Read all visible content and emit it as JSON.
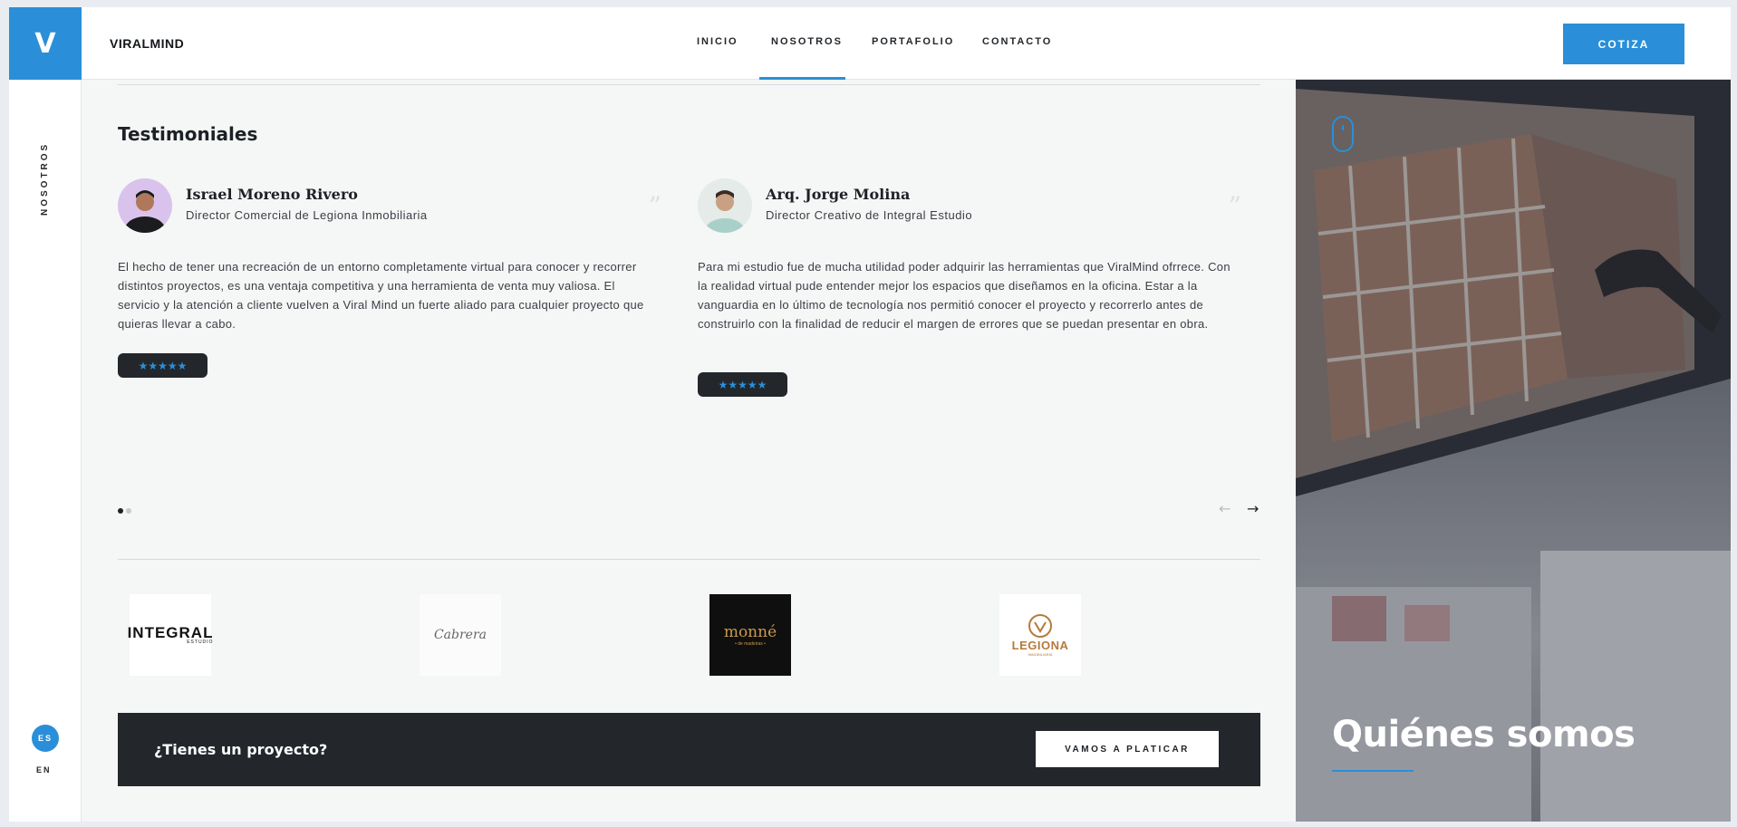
{
  "header": {
    "logo_letter": "V",
    "brand": "VIRALMIND",
    "nav": [
      {
        "label": "INICIO"
      },
      {
        "label": "NOSOTROS"
      },
      {
        "label": "PORTAFOLIO"
      },
      {
        "label": "CONTACTO"
      }
    ],
    "cta_label": "COTIZA"
  },
  "rail": {
    "section_label": "NOSOTROS",
    "lang_active": "ES",
    "lang_other": "EN"
  },
  "testimonials": {
    "title": "Testimoniales",
    "items": [
      {
        "name": "Israel Moreno Rivero",
        "role": "Director Comercial de Legiona Inmobiliaria",
        "quote_mark": "”",
        "text": "El hecho de tener una recreación de un entorno completamente virtual para conocer y recorrer distintos proyectos, es una ventaja competitiva y una herramienta de venta muy valiosa. El servicio y la atención a cliente vuelven a Viral Mind un fuerte aliado para cualquier proyecto que quieras llevar a cabo.",
        "rating": "★★★★★"
      },
      {
        "name": "Arq. Jorge Molina",
        "role": "Director Creativo de Integral Estudio",
        "quote_mark": "”",
        "text": "Para mi estudio fue de mucha utilidad poder adquirir las herramientas que ViralMind ofrrece. Con la realidad virtual pude entender mejor los espacios que diseñamos en la oficina. Estar a la vanguardia en lo último de tecnología nos permitió conocer el proyecto y recorrerlo antes de construirlo con la finalidad de reducir el margen de errores que se puedan presentar en obra.",
        "rating": "★★★★★"
      }
    ],
    "prev_arrow": "←",
    "next_arrow": "→"
  },
  "partners": [
    {
      "name": "INTEGRAL",
      "sub": "ESTUDIO"
    },
    {
      "name": "Cabrera",
      "sub": ""
    },
    {
      "name": "monné",
      "sub": "• de madeiras •"
    },
    {
      "name": "LEGIONA",
      "sub": "INMOBILIARIA"
    }
  ],
  "cta_bar": {
    "text": "¿Tienes un proyecto?",
    "button": "VAMOS A PLATICAR"
  },
  "hero": {
    "title": "Quiénes somos"
  },
  "colors": {
    "accent": "#2a8fd8",
    "dark": "#23272b"
  }
}
